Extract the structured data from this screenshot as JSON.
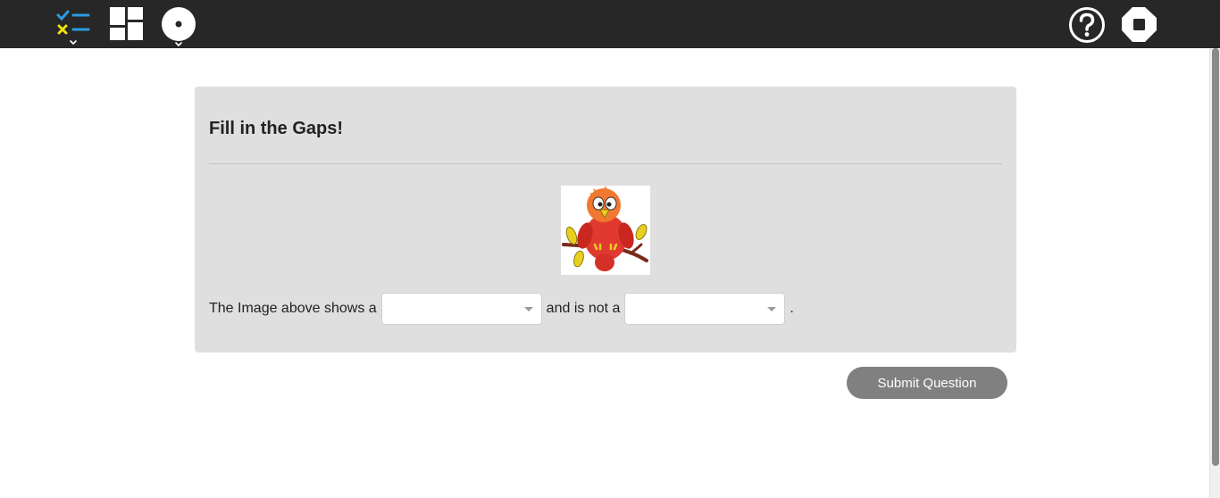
{
  "toolbar": {
    "left_icons": [
      "checklist-icon",
      "grid-layout-icon",
      "record-disc-icon"
    ],
    "right_icons": [
      "help-icon",
      "stop-icon"
    ]
  },
  "panel": {
    "title": "Fill in the Gaps!",
    "image_icon": "parrot-on-branch-image",
    "sentence": {
      "part1": "The Image above shows a",
      "part2": "and is not a",
      "end": "."
    },
    "gap1_value": "",
    "gap2_value": ""
  },
  "submit_label": "Submit Question",
  "colors": {
    "topbar": "#272727",
    "panel": "#dfdfdf",
    "button": "#808080",
    "check_blue": "#2b9be0",
    "cross_yellow": "#f0e010"
  }
}
